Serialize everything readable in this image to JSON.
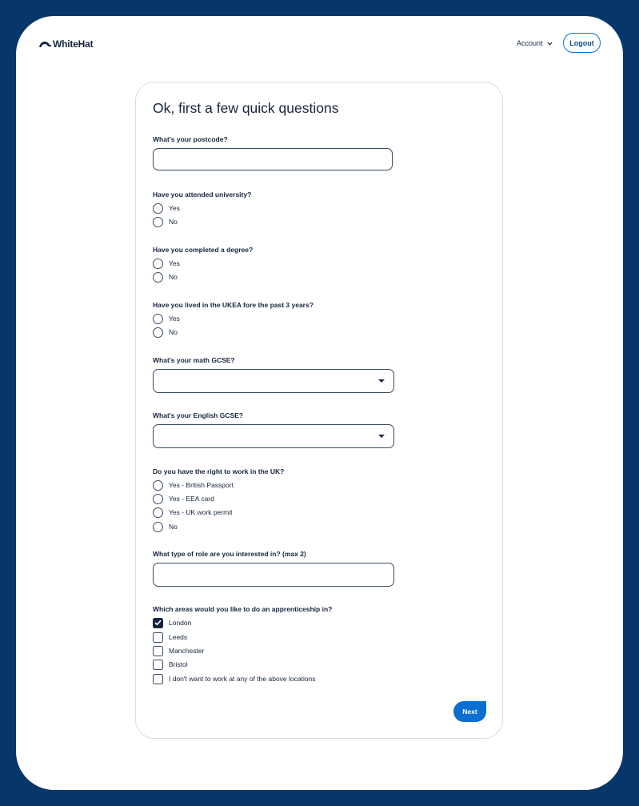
{
  "header": {
    "logo_text": "WhiteHat",
    "account_label": "Account",
    "logout_label": "Logout"
  },
  "form": {
    "title": "Ok, first a few quick questions",
    "postcode": {
      "label": "What's your postcode?",
      "value": ""
    },
    "university": {
      "label": "Have you attended university?",
      "options": [
        "Yes",
        "No"
      ]
    },
    "degree": {
      "label": "Have you completed a degree?",
      "options": [
        "Yes",
        "No"
      ]
    },
    "ukea": {
      "label": "Have you lived in the UKEA fore the past 3 years?",
      "options": [
        "Yes",
        "No"
      ]
    },
    "math_gcse": {
      "label": "What's your math GCSE?",
      "value": ""
    },
    "english_gcse": {
      "label": "What's your English GCSE?",
      "value": ""
    },
    "right_to_work": {
      "label": "Do you have the right to work in the UK?",
      "options": [
        "Yes - British Passport",
        "Yes - EEA card",
        "Yes - UK work permit",
        "No"
      ]
    },
    "role": {
      "label": "What type of role are you interested in? (max 2)",
      "value": ""
    },
    "areas": {
      "label": "Which areas would you like to do an apprenticeship in?",
      "options": [
        {
          "label": "London",
          "checked": true
        },
        {
          "label": "Leeds",
          "checked": false
        },
        {
          "label": "Manchester",
          "checked": false
        },
        {
          "label": "Bristol",
          "checked": false
        },
        {
          "label": "I don't want to work at any of the above locations",
          "checked": false
        }
      ]
    },
    "next_label": "Next"
  },
  "colors": {
    "frame": "#07366a",
    "accent": "#0a6fd1",
    "text": "#16253d"
  }
}
